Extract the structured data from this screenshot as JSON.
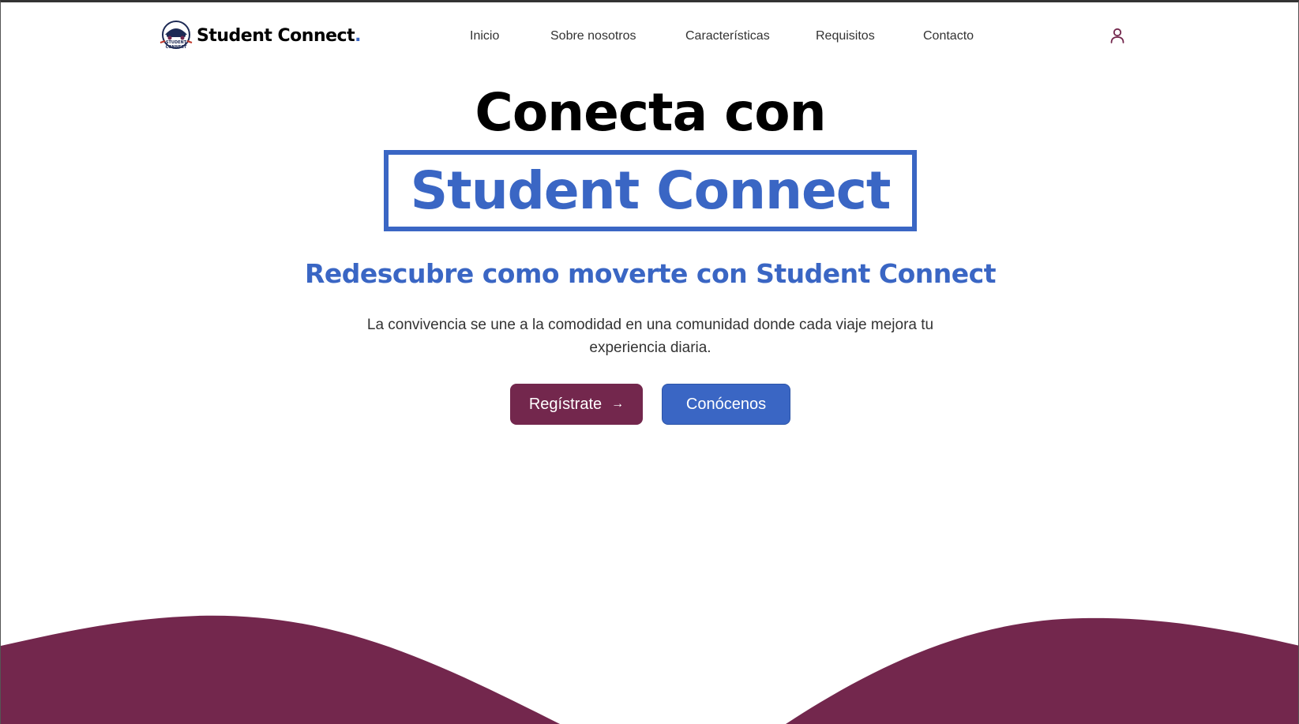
{
  "brand": {
    "name": "Student Connect",
    "dot": ".",
    "logo_icon": "student-connect-car-badge",
    "logo_text_line1": "STUDENT",
    "logo_text_line2": "CONNECT"
  },
  "nav": {
    "items": [
      {
        "label": "Inicio"
      },
      {
        "label": "Sobre nosotros"
      },
      {
        "label": "Características"
      },
      {
        "label": "Requisitos"
      },
      {
        "label": "Contacto"
      }
    ],
    "user_icon": "user-icon"
  },
  "hero": {
    "title": "Conecta con",
    "highlight": "Student Connect",
    "subtitle": "Redescubre como moverte con Student Connect",
    "description": "La convivencia se une a la comodidad en una comunidad donde cada viaje mejora tu experiencia diaria."
  },
  "buttons": {
    "register": {
      "label": "Regístrate",
      "icon": "arrow-right-icon",
      "icon_glyph": "→"
    },
    "about": {
      "label": "Conócenos"
    }
  },
  "colors": {
    "primary_blue": "#3a66c4",
    "wine": "#73274d",
    "text": "#333333"
  }
}
